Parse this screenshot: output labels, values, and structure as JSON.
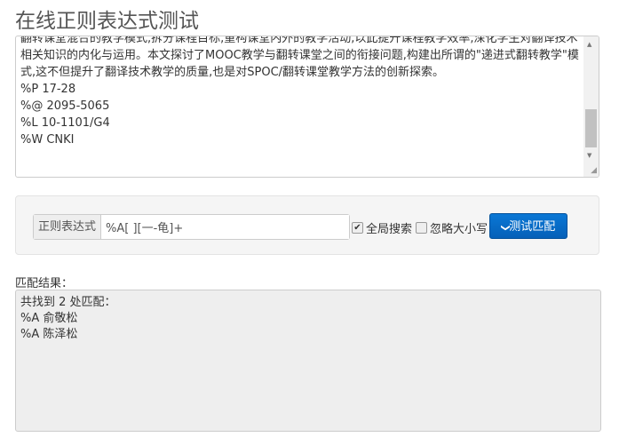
{
  "title": "在线正则表达式测试",
  "source_lines": [
    "翻转课堂混合的教学模式,拆分课程目标,重构课堂内外的教学活动,以此提升课程教学效率,深化学生对翻译技术",
    "相关知识的内化与运用。本文探讨了MOOC教学与翻转课堂之间的衔接问题,构建出所谓的\"递进式翻转教学\"模",
    "式,这不但提升了翻译技术教学的质量,也是对SPOC/翻转课堂教学方法的创新探索。",
    "%P 17-28",
    "%@ 2095-5065",
    "%L 10-1101/G4",
    "%W CNKI"
  ],
  "regex": {
    "label": "正则表达式",
    "value": "%A[ ][一-龟]+"
  },
  "options": {
    "global": {
      "label": "全局搜索",
      "checked": true
    },
    "ignore_case": {
      "label": "忽略大小写",
      "checked": false
    }
  },
  "test_button": "测试匹配",
  "result_label": "匹配结果：",
  "result_lines": [
    "共找到 2 处匹配：",
    "%A 俞敬松",
    "%A 陈泽松"
  ]
}
